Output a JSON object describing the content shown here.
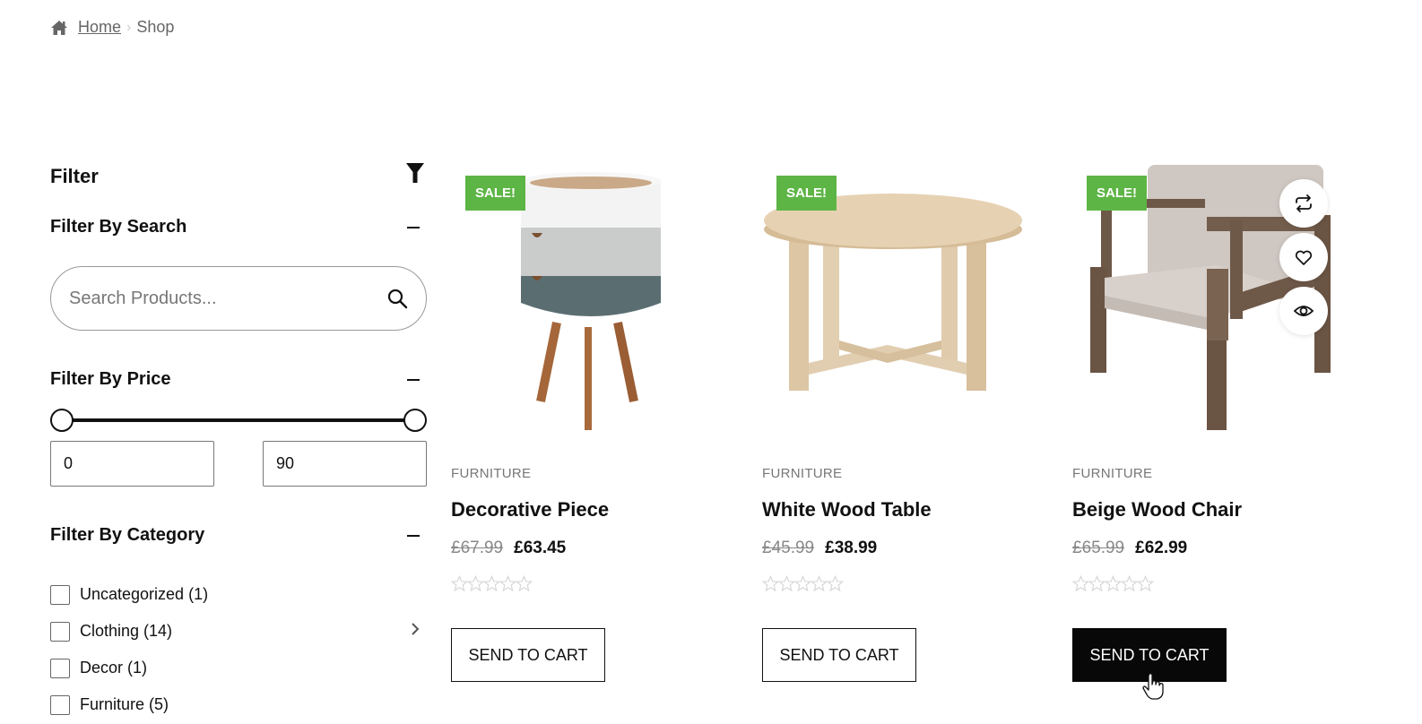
{
  "breadcrumb": {
    "home_icon": "home-icon",
    "home_label": "Home",
    "current": "Shop"
  },
  "sidebar": {
    "title": "Filter",
    "filter_icon": "funnel-icon",
    "search_section": {
      "title": "Filter By Search",
      "placeholder": "Search Products...",
      "value": ""
    },
    "price_section": {
      "title": "Filter By Price",
      "min_value": "0",
      "max_value": "90",
      "slider_range": [
        0,
        90
      ],
      "slider_selected": [
        0,
        90
      ]
    },
    "category_section": {
      "title": "Filter By Category",
      "items": [
        {
          "label": "Uncategorized (1)",
          "checked": false,
          "has_children": false
        },
        {
          "label": "Clothing (14)",
          "checked": false,
          "has_children": true
        },
        {
          "label": "Decor (1)",
          "checked": false,
          "has_children": false
        },
        {
          "label": "Furniture (5)",
          "checked": false,
          "has_children": false
        }
      ]
    }
  },
  "products": [
    {
      "badge": "SALE!",
      "category": "FURNITURE",
      "name": "Decorative Piece",
      "old_price": "£67.99",
      "price": "£63.45",
      "rating": 0,
      "rating_max": 5,
      "button": "SEND TO CART"
    },
    {
      "badge": "SALE!",
      "category": "FURNITURE",
      "name": "White Wood Table",
      "old_price": "£45.99",
      "price": "£38.99",
      "rating": 0,
      "rating_max": 5,
      "button": "SEND TO CART"
    },
    {
      "badge": "SALE!",
      "category": "FURNITURE",
      "name": "Beige Wood Chair",
      "old_price": "£65.99",
      "price": "£62.99",
      "rating": 0,
      "rating_max": 5,
      "button": "SEND TO CART",
      "hover_actions": [
        "compare-icon",
        "heart-icon",
        "eye-icon"
      ]
    }
  ],
  "colors": {
    "sale_badge": "#5db545",
    "active_button": "#080808",
    "text": "#111111",
    "muted": "#777777"
  }
}
